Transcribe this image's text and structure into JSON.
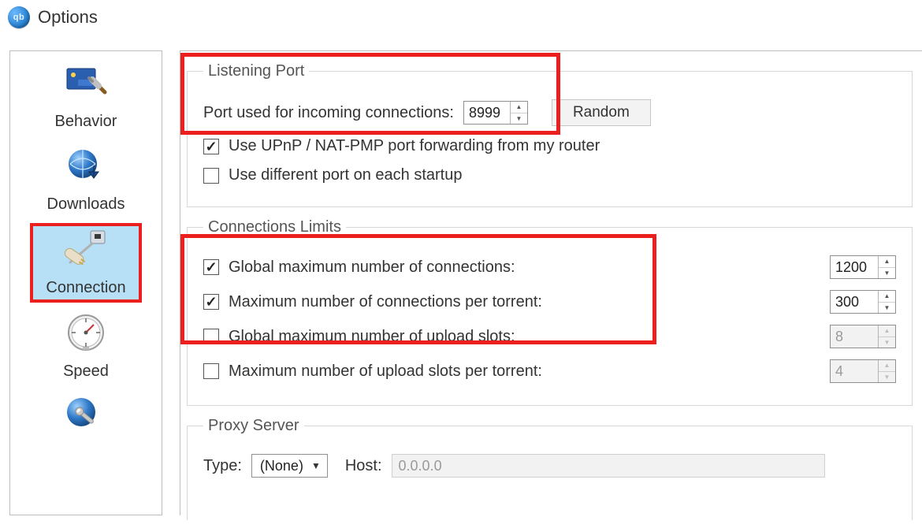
{
  "window": {
    "title": "Options"
  },
  "sidebar": {
    "items": [
      {
        "id": "behavior",
        "label": "Behavior",
        "selected": false
      },
      {
        "id": "downloads",
        "label": "Downloads",
        "selected": false
      },
      {
        "id": "connection",
        "label": "Connection",
        "selected": true
      },
      {
        "id": "speed",
        "label": "Speed",
        "selected": false
      }
    ]
  },
  "listening_port": {
    "legend": "Listening Port",
    "port_label": "Port used for incoming connections:",
    "port_value": "8999",
    "random_label": "Random",
    "upnp": {
      "checked": true,
      "label": "Use UPnP / NAT-PMP port forwarding from my router"
    },
    "diffport": {
      "checked": false,
      "label": "Use different port on each startup"
    }
  },
  "connections_limits": {
    "legend": "Connections Limits",
    "global_conn": {
      "checked": true,
      "label": "Global maximum number of connections:",
      "value": "1200"
    },
    "per_torrent": {
      "checked": true,
      "label": "Maximum number of connections per torrent:",
      "value": "300"
    },
    "global_upslots": {
      "checked": false,
      "label": "Global maximum number of upload slots:",
      "value": "8"
    },
    "per_torrent_upslots": {
      "checked": false,
      "label": "Maximum number of upload slots per torrent:",
      "value": "4"
    }
  },
  "proxy": {
    "legend": "Proxy Server",
    "type_label": "Type:",
    "type_value": "(None)",
    "host_label": "Host:",
    "host_value": "0.0.0.0"
  }
}
